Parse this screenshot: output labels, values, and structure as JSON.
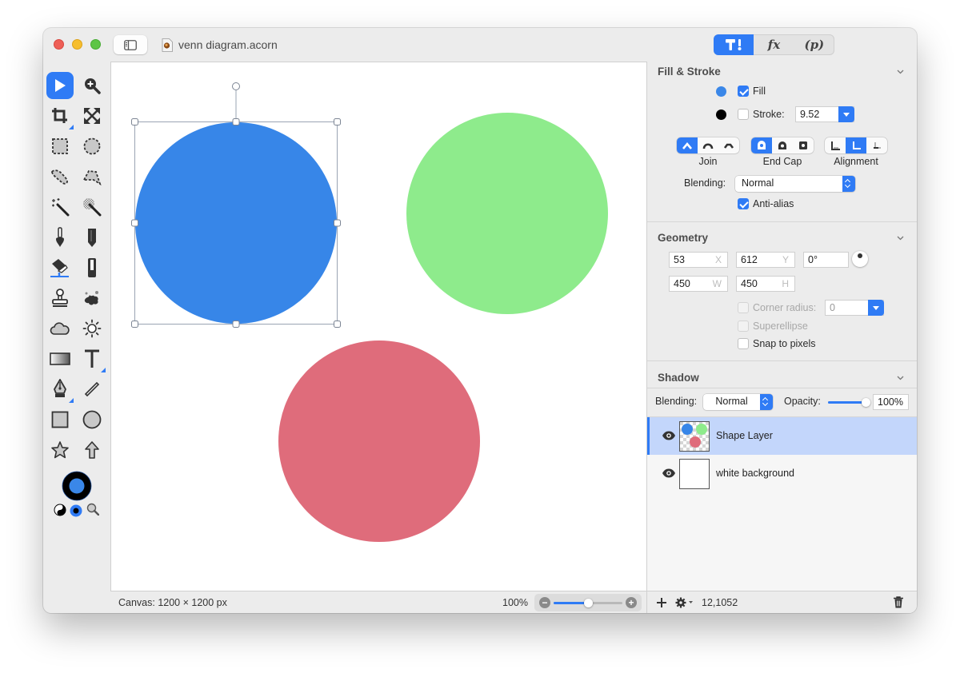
{
  "window": {
    "title": "venn diagram.acorn",
    "inspector_tabs": [
      {
        "name": "tools-tab",
        "label": "",
        "icon": "hammer-icon",
        "active": true
      },
      {
        "name": "filters-tab",
        "label": "fx",
        "active": false
      },
      {
        "name": "plugins-tab",
        "label": "(p)",
        "active": false
      }
    ]
  },
  "toolbox": {
    "tools": [
      {
        "name": "select-tool",
        "icon": "arrow-pointer-icon",
        "active": true
      },
      {
        "name": "zoom-tool",
        "icon": "magnifier-plus-icon"
      },
      {
        "name": "crop-tool",
        "icon": "crop-icon",
        "has_submenu": true
      },
      {
        "name": "transform-tool",
        "icon": "expand-arrows-icon"
      },
      {
        "name": "rect-select-tool",
        "icon": "dashed-square-icon"
      },
      {
        "name": "ellipse-select-tool",
        "icon": "dashed-circle-icon"
      },
      {
        "name": "lasso-tool",
        "icon": "lasso-icon"
      },
      {
        "name": "polygon-lasso-tool",
        "icon": "polygon-lasso-icon"
      },
      {
        "name": "magic-wand-tool",
        "icon": "magic-wand-icon"
      },
      {
        "name": "instant-alpha-tool",
        "icon": "instant-alpha-wand-icon"
      },
      {
        "name": "brush-tool",
        "icon": "brush-icon"
      },
      {
        "name": "pencil-tool",
        "icon": "pencil-icon"
      },
      {
        "name": "paint-bucket-tool",
        "icon": "paint-bucket-icon"
      },
      {
        "name": "eraser-tool",
        "icon": "eraser-icon"
      },
      {
        "name": "clone-tool",
        "icon": "stamp-icon"
      },
      {
        "name": "smudge-tool",
        "icon": "splat-icon"
      },
      {
        "name": "burn-tool",
        "icon": "cloud-icon"
      },
      {
        "name": "dodge-tool",
        "icon": "sun-icon"
      },
      {
        "name": "gradient-tool",
        "icon": "gradient-icon"
      },
      {
        "name": "text-tool",
        "icon": "text-t-icon",
        "has_submenu": true
      },
      {
        "name": "bezier-tool",
        "icon": "pen-nib-icon",
        "has_submenu": true
      },
      {
        "name": "line-tool",
        "icon": "line-icon"
      },
      {
        "name": "rectangle-tool",
        "icon": "square-shape-icon"
      },
      {
        "name": "oval-tool",
        "icon": "circle-shape-icon"
      },
      {
        "name": "star-tool",
        "icon": "star-icon"
      },
      {
        "name": "arrow-tool",
        "icon": "arrow-up-icon"
      }
    ],
    "stroke_color": "#000000",
    "fill_color": "#3a87e8"
  },
  "canvas": {
    "shapes": [
      {
        "name": "blue-circle",
        "color": "#3786e8",
        "selected": true
      },
      {
        "name": "green-circle",
        "color": "#8eeb8c",
        "selected": false
      },
      {
        "name": "red-circle",
        "color": "#df6c7b",
        "selected": false
      }
    ]
  },
  "status": {
    "canvas_size": "Canvas: 1200 × 1200 px",
    "zoom_pct": "100%",
    "zoom_slider_fraction": 0.5
  },
  "inspector": {
    "fill_stroke": {
      "title": "Fill & Stroke",
      "fill_label": "Fill",
      "fill_checked": true,
      "fill_color": "#3a87e8",
      "stroke_label": "Stroke:",
      "stroke_checked": false,
      "stroke_color": "#000000",
      "stroke_width": "9.52",
      "join_label": "Join",
      "endcap_label": "End Cap",
      "alignment_label": "Alignment",
      "blending_label": "Blending:",
      "blending_value": "Normal",
      "antialias_label": "Anti-alias",
      "antialias_checked": true
    },
    "geometry": {
      "title": "Geometry",
      "x": "53",
      "x_unit": "X",
      "y": "612",
      "y_unit": "Y",
      "angle": "0°",
      "w": "450",
      "w_unit": "W",
      "h": "450",
      "h_unit": "H",
      "corner_radius_label": "Corner radius:",
      "corner_radius_value": "0",
      "superellipse_label": "Superellipse",
      "snap_label": "Snap to pixels"
    },
    "shadow": {
      "title": "Shadow",
      "blending_label": "Blending:",
      "blending_value": "Normal",
      "opacity_label": "Opacity:",
      "opacity_value": "100%",
      "opacity_fraction": 1.0
    },
    "layers": [
      {
        "name": "Shape Layer",
        "visible": true,
        "selected": true
      },
      {
        "name": "white background",
        "visible": true,
        "selected": false
      }
    ],
    "coords": "12,1052"
  }
}
